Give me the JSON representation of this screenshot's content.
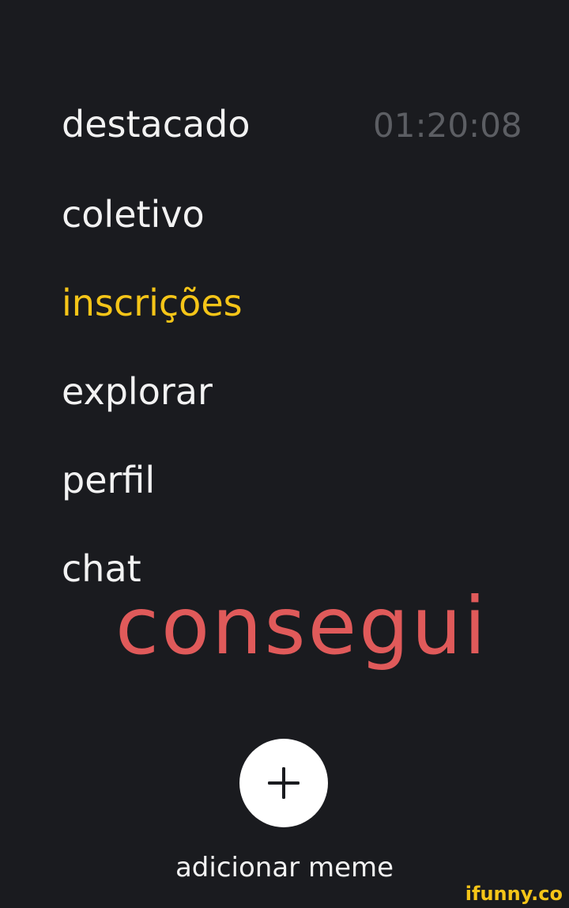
{
  "menu": {
    "items": [
      {
        "label": "destacado"
      },
      {
        "label": "coletivo"
      },
      {
        "label": "inscrições"
      },
      {
        "label": "explorar"
      },
      {
        "label": "perfil"
      },
      {
        "label": "chat"
      }
    ],
    "active_index": 2,
    "timer": "01:20:08"
  },
  "overlay": {
    "text": "consegui"
  },
  "add": {
    "icon": "plus-icon",
    "label": "adicionar meme"
  },
  "watermark": {
    "text": "ifunny.co"
  },
  "colors": {
    "background": "#1a1b1f",
    "text": "#f2f2f2",
    "active": "#f5c518",
    "timer": "#5c5e63",
    "overlay": "#e05a5a"
  }
}
